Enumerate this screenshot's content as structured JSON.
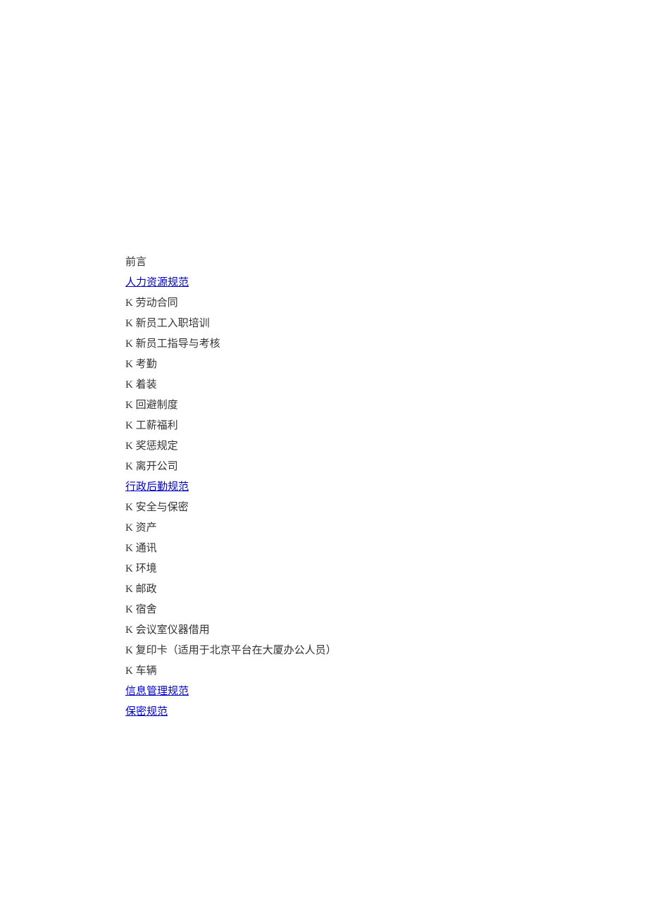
{
  "toc": {
    "preface": "前言",
    "section1": {
      "title": "人力资源规范",
      "items": [
        "劳动合同",
        "新员工入职培训",
        "新员工指导与考核",
        "考勤",
        "着装",
        "回避制度",
        "工薪福利",
        "奖惩规定",
        "离开公司"
      ]
    },
    "section2": {
      "title": "行政后勤规范",
      "items": [
        "安全与保密",
        "资产",
        "通讯",
        "环境",
        "邮政",
        "宿舍",
        "会议室仪器借用",
        "复印卡（适用于北京平台在大厦办公人员）",
        "车辆"
      ]
    },
    "section3": {
      "title": "信息管理规范"
    },
    "section4": {
      "title": "保密规范"
    },
    "prefix": "K "
  }
}
